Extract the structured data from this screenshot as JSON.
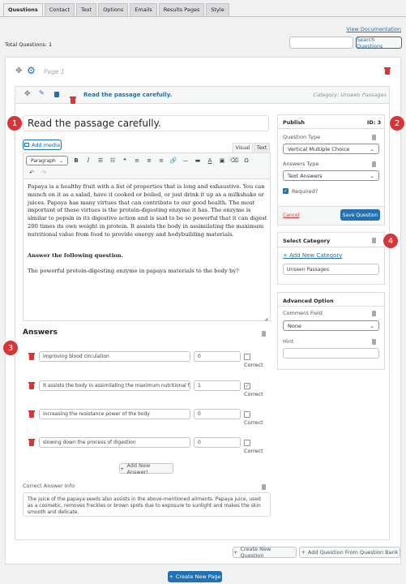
{
  "tabs": [
    "Questions",
    "Contact",
    "Text",
    "Options",
    "Emails",
    "Results Pages",
    "Style"
  ],
  "header": {
    "view_documentation": "View Documentation",
    "total_questions": "Total Questions: 1",
    "search_placeholder": "",
    "search_button": "Search Questions"
  },
  "page": {
    "title": "Page 1"
  },
  "question": {
    "row_title": "Read the passage carefully.",
    "category_label": "Category: Unseen Passages",
    "title_value": "Read the passage carefully.",
    "add_media": "Add media",
    "tab_visual": "Visual",
    "tab_text": "Text",
    "format_select": "Paragraph",
    "passage": "Papaya is a healthy fruit with a list of properties that is long and exhaustive. You can munch on it as a salad, have it cooked or boiled, or just drink it up as a milkshake or juices. Papaya has many virtues that can contribute to our good health. The most important of these virtues is the protein-digesting enzyme it has. The enzyme is similar to pepsin in its digestive action and is said to be so powerful that it can digest 200 times its own weight in protein. It assists the body in assimilating the maximum nutritional value from food to provide energy and bodybuilding materials.",
    "instruction": "Answer the following question.",
    "prompt": "The powerful protein-digesting enzyme in papaya materials to the body by?"
  },
  "answers": {
    "heading": "Answers",
    "correct_label": "Correct",
    "items": [
      {
        "text": "improving blood circulation",
        "points": "0",
        "correct": ""
      },
      {
        "text": "It assists the body in assimilating the maximum nutritional fror",
        "points": "1",
        "correct": "✓"
      },
      {
        "text": "increasing the resistance power of the body",
        "points": "0",
        "correct": ""
      },
      {
        "text": "slowing down the process of digestion",
        "points": "0",
        "correct": ""
      }
    ],
    "add_new": "Add New Answer!",
    "correct_info_label": "Correct Answer Info",
    "correct_info_text": "The juice of the papaya seeds also assists in the above-mentioned ailments. Papaya juice, used as a cosmetic, removes freckles or brown spots due to exposure to sunlight and makes the skin smooth and delicate."
  },
  "publish": {
    "heading": "Publish",
    "id": "ID: 3",
    "question_type_label": "Question Type",
    "question_type_value": "Vertical Multiple Choice",
    "answers_type_label": "Answers Type",
    "answers_type_value": "Text Answers",
    "required_label": "Required?",
    "cancel": "Cancel",
    "save": "Save Question"
  },
  "category": {
    "heading": "Select Category",
    "add_new": "+ Add New Category",
    "value": "Unseen Passages"
  },
  "advanced": {
    "heading": "Advanced Option",
    "comment_label": "Comment Field",
    "comment_value": "None",
    "hint_label": "Hint",
    "hint_value": ""
  },
  "bottom": {
    "create_question": "Create New Question",
    "add_from_bank": "Add Question From Question Bank",
    "create_page": "Create New Page"
  },
  "badges": [
    "1",
    "2",
    "3",
    "4"
  ],
  "colors": {
    "accent": "#2271b1",
    "danger": "#d63638",
    "badge": "#d63638"
  }
}
